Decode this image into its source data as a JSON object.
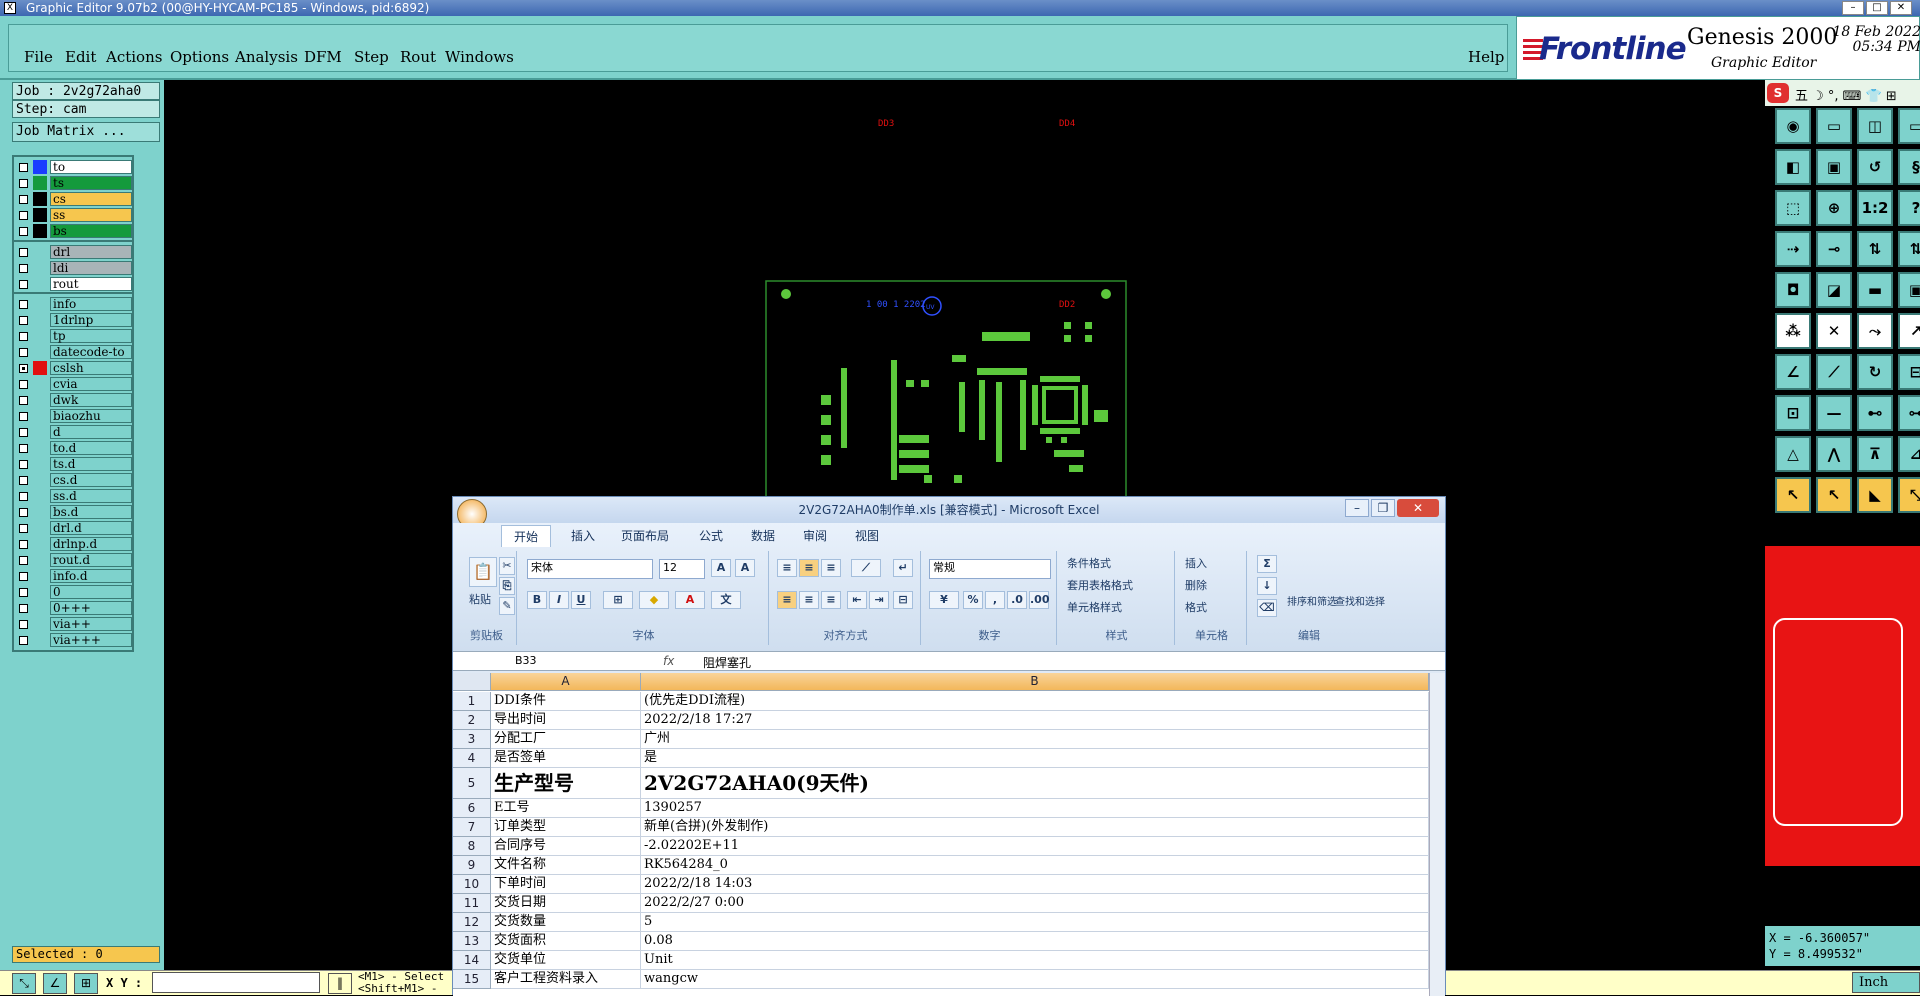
{
  "window": {
    "title": "Graphic Editor 9.07b2 (00@HY-HYCAM-PC185 - Windows, pid:6892)"
  },
  "menu": {
    "items": [
      "File",
      "Edit",
      "Actions",
      "Options",
      "Analysis",
      "DFM",
      "Step",
      "Rout",
      "Windows"
    ],
    "help": "Help"
  },
  "logo": {
    "brand": "Frontline",
    "product": "Genesis 2000",
    "subtitle": "Graphic Editor",
    "date": "18 Feb 2022",
    "time": "05:34 PM"
  },
  "job": {
    "job_label": "Job : 2v2g72aha0",
    "step_label": "Step: cam",
    "matrix_button": "Job Matrix ..."
  },
  "layers": {
    "group1": [
      {
        "name": "to",
        "color": "#1a3cff",
        "fill": "#ffffff"
      },
      {
        "name": "ts",
        "color": "#149a3c",
        "fill": "#149a3c"
      },
      {
        "name": "cs",
        "color": "#000000",
        "fill": "#f6c64e"
      },
      {
        "name": "ss",
        "color": "#000000",
        "fill": "#f6c64e"
      },
      {
        "name": "bs",
        "color": "#000000",
        "fill": "#149a3c"
      }
    ],
    "group2": [
      {
        "name": "drl",
        "fill": "#a8b4b8"
      },
      {
        "name": "ldi",
        "fill": "#a8b4b8"
      },
      {
        "name": "rout",
        "fill": "#ffffff"
      }
    ],
    "group3": [
      {
        "name": "info"
      },
      {
        "name": "1drlnp"
      },
      {
        "name": "tp"
      },
      {
        "name": "datecode-to"
      },
      {
        "name": "cslsh",
        "color": "#e01010",
        "active": true
      },
      {
        "name": "cvia"
      },
      {
        "name": "dwk"
      },
      {
        "name": "biaozhu"
      },
      {
        "name": "d"
      },
      {
        "name": "to.d"
      },
      {
        "name": "ts.d"
      },
      {
        "name": "cs.d"
      },
      {
        "name": "ss.d"
      },
      {
        "name": "bs.d"
      },
      {
        "name": "drl.d"
      },
      {
        "name": "drlnp.d"
      },
      {
        "name": "rout.d"
      },
      {
        "name": "info.d"
      },
      {
        "name": "0"
      },
      {
        "name": "0+++"
      },
      {
        "name": "via++"
      },
      {
        "name": "via+++"
      }
    ]
  },
  "selected": "Selected : 0",
  "status": {
    "xy_label": "X Y :",
    "hint1": "<M1> - Select",
    "hint2": "<Shift+M1> -",
    "units": "Inch"
  },
  "coords": {
    "x": "X = -6.360057\"",
    "y": "Y = 8.499532\""
  },
  "canvas": {
    "labels": [
      "DD3",
      "DD4",
      "DD2"
    ],
    "board_text": "1 00 1 2202",
    "mark": "UV"
  },
  "ime": {
    "text": "五 ☽ °, ⌨ 👕 ⊞"
  },
  "excel": {
    "title": "2V2G72AHA0制作单.xls  [兼容模式]  -  Microsoft Excel",
    "tabs": [
      "开始",
      "插入",
      "页面布局",
      "公式",
      "数据",
      "审阅",
      "视图"
    ],
    "groups": {
      "clipboard": "剪贴板",
      "font": "字体",
      "alignment": "对齐方式",
      "number": "数字",
      "styles": "样式",
      "cells": "单元格",
      "editing": "编辑"
    },
    "buttons": {
      "paste": "粘贴",
      "cond_format": "条件格式",
      "table_format": "套用表格格式",
      "cell_style": "单元格样式",
      "insert": "插入",
      "delete": "删除",
      "format": "格式",
      "sort": "排序和筛选",
      "find": "查找和选择"
    },
    "font_name": "宋体",
    "font_size": "12",
    "number_format": "常规",
    "name_box": "B33",
    "fx": "fx",
    "formula": "阻焊塞孔",
    "columns": [
      "A",
      "B"
    ],
    "rows": [
      {
        "n": "1",
        "a": "DDI条件",
        "b": "(优先走DDI流程)"
      },
      {
        "n": "2",
        "a": "导出时间",
        "b": "2022/2/18 17:27"
      },
      {
        "n": "3",
        "a": "分配工厂",
        "b": "广州"
      },
      {
        "n": "4",
        "a": "是否签单",
        "b": "是"
      },
      {
        "n": "5",
        "a": "生产型号",
        "b": "2V2G72AHA0(9天件)",
        "big": true
      },
      {
        "n": "6",
        "a": "E工号",
        "b": "1390257"
      },
      {
        "n": "7",
        "a": "订单类型",
        "b": "新单(合拼)(外发制作)"
      },
      {
        "n": "8",
        "a": "合同序号",
        "b": "-2.02202E+11"
      },
      {
        "n": "9",
        "a": "文件名称",
        "b": "RK564284_0"
      },
      {
        "n": "10",
        "a": "下单时间",
        "b": "2022/2/18 14:03"
      },
      {
        "n": "11",
        "a": "交货日期",
        "b": "2022/2/27 0:00"
      },
      {
        "n": "12",
        "a": "交货数量",
        "b": "5"
      },
      {
        "n": "13",
        "a": "交货面积",
        "b": "0.08"
      },
      {
        "n": "14",
        "a": "交货单位",
        "b": "Unit"
      },
      {
        "n": "15",
        "a": "客户工程资料录入",
        "b": "wangcw"
      }
    ]
  }
}
